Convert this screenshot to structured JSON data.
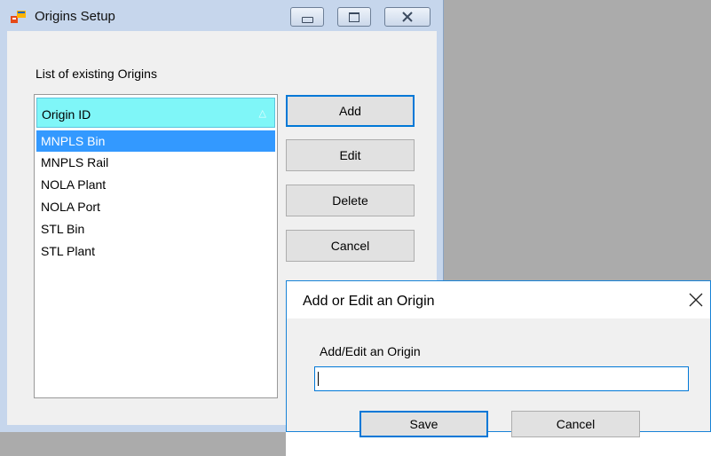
{
  "main_window": {
    "title": "Origins Setup",
    "list_caption": "List of existing Origins",
    "grid": {
      "column_header": "Origin ID",
      "sort_indicator": "ascending",
      "rows": [
        "MNPLS Bin",
        "MNPLS Rail",
        "NOLA Plant",
        "NOLA Port",
        "STL Bin",
        "STL Plant"
      ],
      "selected_index": 0
    },
    "buttons": {
      "add": "Add",
      "edit": "Edit",
      "delete": "Delete",
      "cancel": "Cancel"
    }
  },
  "dialog": {
    "title": "Add or Edit an Origin",
    "field_label": "Add/Edit an Origin",
    "field_value": "",
    "buttons": {
      "save": "Save",
      "cancel": "Cancel"
    }
  },
  "colors": {
    "header_bg": "#7ff6f8",
    "selection": "#3399ff",
    "focus_border": "#0078d7",
    "window_frame": "#c6d6ec"
  },
  "icons": {
    "app": "app-window-icon",
    "minimize": "minimize-icon",
    "maximize": "maximize-icon",
    "close": "close-icon",
    "sort": "sort-ascending-icon"
  }
}
